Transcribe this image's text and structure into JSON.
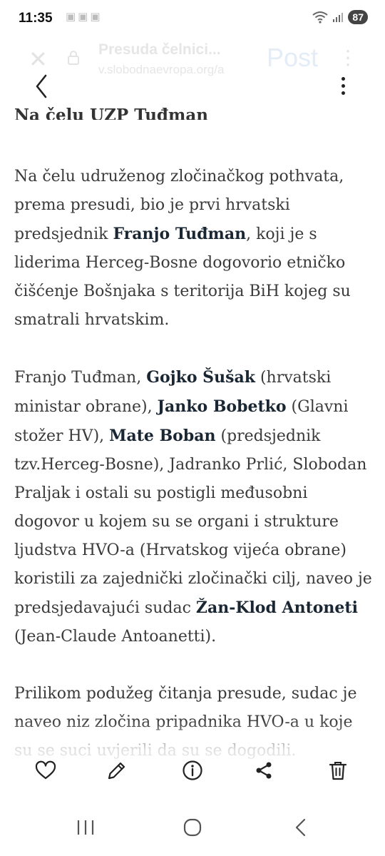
{
  "status_bar": {
    "time": "11:35",
    "battery": "87"
  },
  "browser": {
    "page_title": "Presuda čelnici...",
    "url": "v.slobodnaevropa.org/a",
    "post_label": "Post"
  },
  "article": {
    "section_heading": "Na čelu UZP Tuđman",
    "p1": {
      "t1": "Na čelu udruženog zločinačkog pothvata, prema presudi, bio je prvi hrvatski predsjednik ",
      "b1": "Franjo Tuđman",
      "t2": ", koji je s liderima Herceg-Bosne dogovorio etničko čišćenje Bošnjaka s teritorija BiH kojeg su smatrali hrvatskim."
    },
    "p2": {
      "t1": "Franjo Tuđman, ",
      "b1": "Gojko Šušak",
      "t2": " (hrvatski ministar obrane), ",
      "b2": "Janko Bobetko",
      "t3": " (Glavni stožer HV), ",
      "b3": "Mate Boban",
      "t4": " (predsjednik tzv.Herceg-Bosne), Jadranko Prlić, Slobodan Praljak i ostali su postigli međusobni dogovor u kojem su se organi i strukture ljudstva HVO-a (Hrvatskog vijeća obrane) koristili za zajednički zločinački cilj, naveo je predsjedavajući sudac ",
      "b4": "Žan-Klod Antoneti",
      "t5": " (Jean-Claude Antoanetti)."
    },
    "p3": "Prilikom podužeg čitanja presude, sudac je naveo niz zločina pripadnika HVO-a u koje su se suci uvjerili da su se dogodili."
  },
  "icons": {
    "back": "chevron-left-icon",
    "more": "more-vertical-icon",
    "like": "heart-icon",
    "edit": "pencil-icon",
    "info": "info-icon",
    "share": "share-icon",
    "delete": "trash-icon"
  }
}
